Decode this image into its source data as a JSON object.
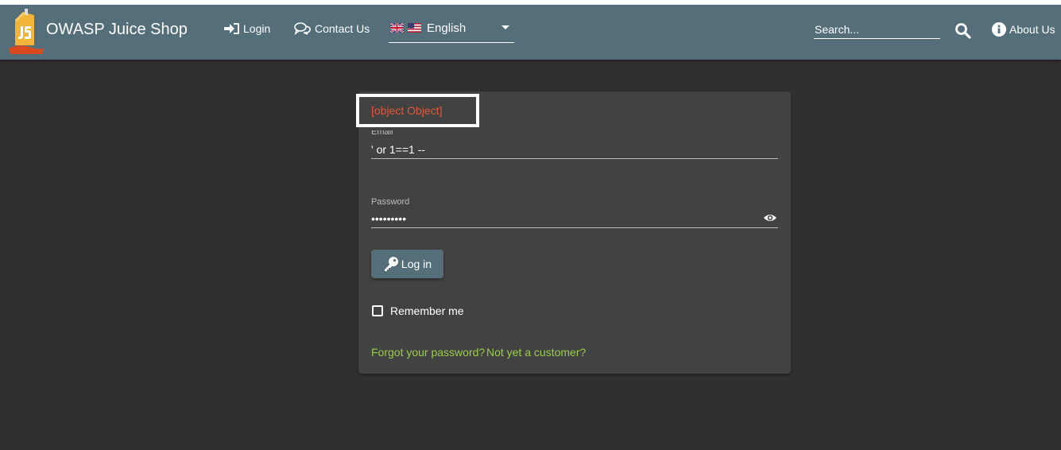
{
  "header": {
    "app_title": "OWASP Juice Shop",
    "logo_icon": "juice-box-logo",
    "nav": {
      "login_label": "Login",
      "login_icon": "sign-in-icon",
      "contact_label": "Contact Us",
      "contact_icon": "comments-icon"
    },
    "language": {
      "selected": "English",
      "flags": [
        "uk-flag-icon",
        "us-flag-icon"
      ]
    },
    "search": {
      "placeholder": "Search..."
    },
    "about_label": "About Us",
    "about_icon": "info-circle-icon",
    "colors": {
      "toolbar": "#546e7a"
    }
  },
  "login_form": {
    "error_message": "[object Object]",
    "email": {
      "label": "Email",
      "value": "' or 1==1 --"
    },
    "password": {
      "label": "Password",
      "value": "secret123"
    },
    "login_button": {
      "label": "Log in",
      "icon": "key-icon"
    },
    "remember_me": {
      "label": "Remember me",
      "checked": false
    },
    "forgot_password_link": "Forgot your password?",
    "register_link": "Not yet a customer?",
    "colors": {
      "error": "#e2573d",
      "link": "#9acd4a",
      "card": "#424242"
    }
  }
}
